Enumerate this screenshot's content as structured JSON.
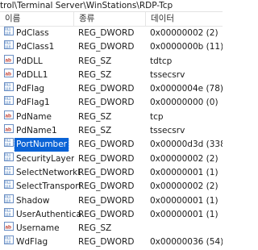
{
  "path": "trol\\Terminal Server\\WinStations\\RDP-Tcp",
  "columns": {
    "name": "이름",
    "type": "종류",
    "data": "데이터"
  },
  "rows": [
    {
      "name": "PdClass",
      "type": "REG_DWORD",
      "data": "0x00000002 (2)",
      "icon": "binary-value-icon"
    },
    {
      "name": "PdClass1",
      "type": "REG_DWORD",
      "data": "0x0000000b (11)",
      "icon": "binary-value-icon"
    },
    {
      "name": "PdDLL",
      "type": "REG_SZ",
      "data": "tdtcp",
      "icon": "string-value-icon"
    },
    {
      "name": "PdDLL1",
      "type": "REG_SZ",
      "data": "tssecsrv",
      "icon": "string-value-icon"
    },
    {
      "name": "PdFlag",
      "type": "REG_DWORD",
      "data": "0x0000004e (78)",
      "icon": "binary-value-icon"
    },
    {
      "name": "PdFlag1",
      "type": "REG_DWORD",
      "data": "0x00000000 (0)",
      "icon": "binary-value-icon"
    },
    {
      "name": "PdName",
      "type": "REG_SZ",
      "data": "tcp",
      "icon": "string-value-icon"
    },
    {
      "name": "PdName1",
      "type": "REG_SZ",
      "data": "tssecsrv",
      "icon": "string-value-icon"
    },
    {
      "name": "PortNumber",
      "type": "REG_DWORD",
      "data": "0x00000d3d (3389)",
      "icon": "binary-value-icon",
      "selected": true
    },
    {
      "name": "SecurityLayer",
      "type": "REG_DWORD",
      "data": "0x00000002 (2)",
      "icon": "binary-value-icon"
    },
    {
      "name": "SelectNetworkD...",
      "type": "REG_DWORD",
      "data": "0x00000001 (1)",
      "icon": "binary-value-icon"
    },
    {
      "name": "SelectTransport",
      "type": "REG_DWORD",
      "data": "0x00000002 (2)",
      "icon": "binary-value-icon"
    },
    {
      "name": "Shadow",
      "type": "REG_DWORD",
      "data": "0x00000001 (1)",
      "icon": "binary-value-icon"
    },
    {
      "name": "UserAuthenticati...",
      "type": "REG_DWORD",
      "data": "0x00000001 (1)",
      "icon": "binary-value-icon"
    },
    {
      "name": "Username",
      "type": "REG_SZ",
      "data": "",
      "icon": "string-value-icon"
    },
    {
      "name": "WdFlag",
      "type": "REG_DWORD",
      "data": "0x00000036 (54)",
      "icon": "binary-value-icon"
    }
  ]
}
